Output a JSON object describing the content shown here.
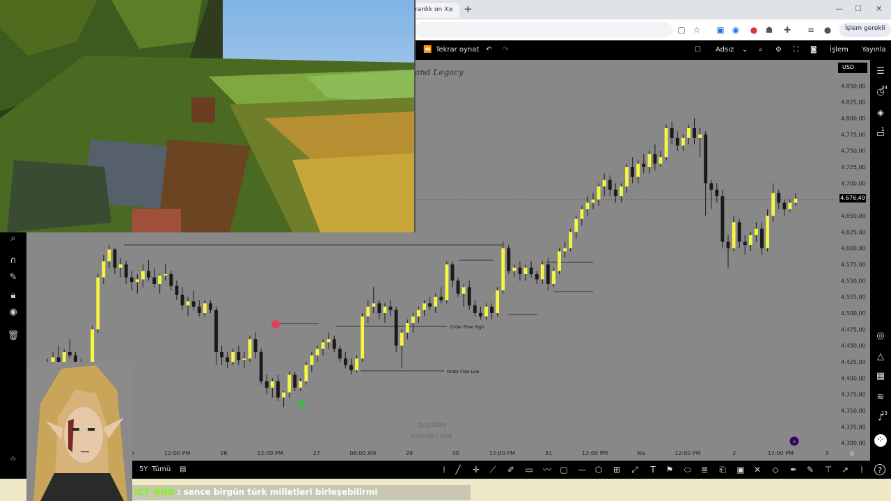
{
  "browser": {
    "tab_title": "ranlık on X",
    "tab_close": "×",
    "new_tab": "+",
    "profile_button": "İşlem gerekli",
    "window_controls": [
      "—",
      "☐",
      "✕"
    ]
  },
  "toolbar": {
    "replay_label": "Tekrar oynat",
    "layout_name": "Adsız",
    "trade_button": "İşlem",
    "publish_button": "Yayınla"
  },
  "chart": {
    "watermark_title": "and Legacy",
    "currency": "USD",
    "last_price_tag": "4.676,49",
    "date_label": "2/4/2026",
    "symbol_label": "XAUUSD | 60M",
    "order_flow_high": "Order Flow High",
    "order_flow_low": "Order Flow Low",
    "price_ticks": [
      "4.850,00",
      "4.825,00",
      "4.800,00",
      "4.775,00",
      "4.750,00",
      "4.725,00",
      "4.700,00",
      "4.675,00",
      "4.650,00",
      "4.625,00",
      "4.600,00",
      "4.575,00",
      "4.550,00",
      "4.525,00",
      "4.500,00",
      "4.475,00",
      "4.450,00",
      "4.425,00",
      "4.400,00",
      "4.375,00",
      "4.350,00",
      "4.325,00",
      "4.300,00"
    ],
    "time_ticks": [
      "25",
      "12:00 PM",
      "26",
      "12:00 PM",
      "27",
      "06:00 AM",
      "29",
      "30",
      "12:00 PM",
      "31",
      "12:00 PM",
      "Nis",
      "12:00 PM",
      "2",
      "12:00 PM",
      "3"
    ]
  },
  "chart_data": {
    "type": "candlestick",
    "title": "XAUUSD | 60M",
    "ylim": [
      4290,
      4860
    ],
    "last_price": 4676.49,
    "candles": [
      [
        4420,
        4430,
        4400,
        4425
      ],
      [
        4425,
        4440,
        4420,
        4432
      ],
      [
        4432,
        4450,
        4420,
        4425
      ],
      [
        4425,
        4445,
        4415,
        4440
      ],
      [
        4440,
        4460,
        4430,
        4435
      ],
      [
        4435,
        4440,
        4410,
        4420
      ],
      [
        4420,
        4430,
        4395,
        4400
      ],
      [
        4400,
        4420,
        4390,
        4415
      ],
      [
        4415,
        4480,
        4410,
        4475
      ],
      [
        4475,
        4560,
        4470,
        4555
      ],
      [
        4555,
        4590,
        4545,
        4580
      ],
      [
        4580,
        4605,
        4570,
        4598
      ],
      [
        4598,
        4600,
        4560,
        4570
      ],
      [
        4570,
        4585,
        4555,
        4575
      ],
      [
        4575,
        4580,
        4545,
        4555
      ],
      [
        4555,
        4565,
        4535,
        4548
      ],
      [
        4548,
        4560,
        4530,
        4552
      ],
      [
        4552,
        4575,
        4540,
        4565
      ],
      [
        4565,
        4582,
        4550,
        4555
      ],
      [
        4555,
        4570,
        4540,
        4545
      ],
      [
        4545,
        4560,
        4530,
        4558
      ],
      [
        4558,
        4575,
        4550,
        4560
      ],
      [
        4560,
        4565,
        4535,
        4542
      ],
      [
        4542,
        4550,
        4520,
        4528
      ],
      [
        4528,
        4540,
        4505,
        4512
      ],
      [
        4512,
        4525,
        4495,
        4518
      ],
      [
        4518,
        4535,
        4505,
        4510
      ],
      [
        4510,
        4520,
        4495,
        4500
      ],
      [
        4500,
        4520,
        4495,
        4515
      ],
      [
        4515,
        4520,
        4500,
        4505
      ],
      [
        4505,
        4510,
        4420,
        4440
      ],
      [
        4440,
        4450,
        4420,
        4432
      ],
      [
        4432,
        4440,
        4415,
        4425
      ],
      [
        4425,
        4445,
        4420,
        4440
      ],
      [
        4440,
        4450,
        4420,
        4428
      ],
      [
        4428,
        4440,
        4415,
        4430
      ],
      [
        4430,
        4465,
        4425,
        4460
      ],
      [
        4460,
        4470,
        4430,
        4440
      ],
      [
        4440,
        4445,
        4390,
        4395
      ],
      [
        4395,
        4405,
        4375,
        4385
      ],
      [
        4385,
        4400,
        4370,
        4395
      ],
      [
        4395,
        4405,
        4365,
        4370
      ],
      [
        4370,
        4380,
        4355,
        4378
      ],
      [
        4378,
        4410,
        4370,
        4405
      ],
      [
        4405,
        4410,
        4380,
        4385
      ],
      [
        4385,
        4400,
        4380,
        4395
      ],
      [
        4395,
        4425,
        4390,
        4420
      ],
      [
        4420,
        4440,
        4410,
        4435
      ],
      [
        4435,
        4450,
        4425,
        4445
      ],
      [
        4445,
        4460,
        4435,
        4455
      ],
      [
        4455,
        4470,
        4445,
        4460
      ],
      [
        4460,
        4465,
        4440,
        4445
      ],
      [
        4445,
        4450,
        4425,
        4430
      ],
      [
        4430,
        4440,
        4415,
        4420
      ],
      [
        4420,
        4430,
        4405,
        4412
      ],
      [
        4412,
        4435,
        4408,
        4430
      ],
      [
        4430,
        4500,
        4425,
        4495
      ],
      [
        4495,
        4520,
        4485,
        4510
      ],
      [
        4510,
        4540,
        4500,
        4515
      ],
      [
        4515,
        4520,
        4490,
        4500
      ],
      [
        4500,
        4515,
        4485,
        4510
      ],
      [
        4510,
        4520,
        4495,
        4505
      ],
      [
        4505,
        4510,
        4440,
        4450
      ],
      [
        4450,
        4475,
        4415,
        4470
      ],
      [
        4470,
        4490,
        4460,
        4485
      ],
      [
        4485,
        4500,
        4470,
        4495
      ],
      [
        4495,
        4510,
        4485,
        4505
      ],
      [
        4505,
        4520,
        4495,
        4515
      ],
      [
        4515,
        4525,
        4505,
        4510
      ],
      [
        4510,
        4530,
        4500,
        4525
      ],
      [
        4525,
        4540,
        4515,
        4520
      ],
      [
        4520,
        4580,
        4515,
        4575
      ],
      [
        4575,
        4580,
        4540,
        4550
      ],
      [
        4550,
        4555,
        4525,
        4530
      ],
      [
        4530,
        4545,
        4510,
        4540
      ],
      [
        4540,
        4550,
        4505,
        4512
      ],
      [
        4512,
        4520,
        4495,
        4500
      ],
      [
        4500,
        4510,
        4490,
        4495
      ],
      [
        4495,
        4515,
        4490,
        4510
      ],
      [
        4510,
        4515,
        4490,
        4500
      ],
      [
        4500,
        4540,
        4495,
        4535
      ],
      [
        4535,
        4610,
        4530,
        4600
      ],
      [
        4600,
        4605,
        4560,
        4565
      ],
      [
        4565,
        4575,
        4555,
        4570
      ],
      [
        4570,
        4580,
        4550,
        4560
      ],
      [
        4560,
        4575,
        4550,
        4570
      ],
      [
        4570,
        4580,
        4555,
        4560
      ],
      [
        4560,
        4565,
        4545,
        4552
      ],
      [
        4552,
        4580,
        4545,
        4575
      ],
      [
        4575,
        4585,
        4535,
        4545
      ],
      [
        4545,
        4570,
        4540,
        4565
      ],
      [
        4565,
        4600,
        4560,
        4595
      ],
      [
        4595,
        4610,
        4585,
        4600
      ],
      [
        4600,
        4630,
        4595,
        4625
      ],
      [
        4625,
        4650,
        4615,
        4645
      ],
      [
        4645,
        4665,
        4635,
        4660
      ],
      [
        4660,
        4680,
        4650,
        4670
      ],
      [
        4670,
        4685,
        4660,
        4675
      ],
      [
        4675,
        4700,
        4665,
        4695
      ],
      [
        4695,
        4715,
        4680,
        4705
      ],
      [
        4705,
        4712,
        4680,
        4690
      ],
      [
        4690,
        4700,
        4670,
        4680
      ],
      [
        4680,
        4700,
        4670,
        4695
      ],
      [
        4695,
        4730,
        4685,
        4725
      ],
      [
        4725,
        4740,
        4700,
        4710
      ],
      [
        4710,
        4735,
        4700,
        4730
      ],
      [
        4730,
        4745,
        4715,
        4725
      ],
      [
        4725,
        4750,
        4715,
        4745
      ],
      [
        4745,
        4760,
        4720,
        4730
      ],
      [
        4730,
        4750,
        4725,
        4740
      ],
      [
        4740,
        4790,
        4735,
        4785
      ],
      [
        4785,
        4795,
        4760,
        4770
      ],
      [
        4770,
        4780,
        4750,
        4758
      ],
      [
        4758,
        4775,
        4750,
        4770
      ],
      [
        4770,
        4790,
        4760,
        4785
      ],
      [
        4785,
        4800,
        4760,
        4770
      ],
      [
        4770,
        4785,
        4740,
        4775
      ],
      [
        4775,
        4780,
        4650,
        4700
      ],
      [
        4700,
        4705,
        4660,
        4690
      ],
      [
        4690,
        4700,
        4670,
        4680
      ],
      [
        4680,
        4690,
        4600,
        4610
      ],
      [
        4610,
        4620,
        4570,
        4600
      ],
      [
        4600,
        4650,
        4595,
        4640
      ],
      [
        4640,
        4645,
        4600,
        4610
      ],
      [
        4610,
        4620,
        4590,
        4605
      ],
      [
        4605,
        4625,
        4595,
        4620
      ],
      [
        4620,
        4640,
        4610,
        4630
      ],
      [
        4630,
        4640,
        4590,
        4600
      ],
      [
        4600,
        4660,
        4595,
        4650
      ],
      [
        4650,
        4700,
        4640,
        4685
      ],
      [
        4685,
        4690,
        4660,
        4670
      ],
      [
        4670,
        4675,
        4650,
        4660
      ],
      [
        4660,
        4675,
        4655,
        4670
      ],
      [
        4670,
        4685,
        4665,
        4676
      ]
    ]
  },
  "left_toolbar": [
    "zoom-icon",
    "magnet-icon",
    "pencil-lock-icon",
    "lock-icon",
    "eye-icon",
    "trash-icon",
    "star-icon"
  ],
  "right_toolbar": {
    "badges": [
      "34",
      "1",
      "13"
    ]
  },
  "bottom": {
    "range_5y": "5Y",
    "range_all": "Tümü"
  },
  "chat": {
    "username": "ICT_GOD",
    "message": " : sence birgün türk milletleri birleşebilirmi"
  },
  "colors": {
    "chart_bg": "#888888",
    "bull_candle": "#f5f542",
    "bear_candle": "#1a1a1a",
    "red_marker": "#e0405a",
    "green_marker": "#4caf50"
  }
}
